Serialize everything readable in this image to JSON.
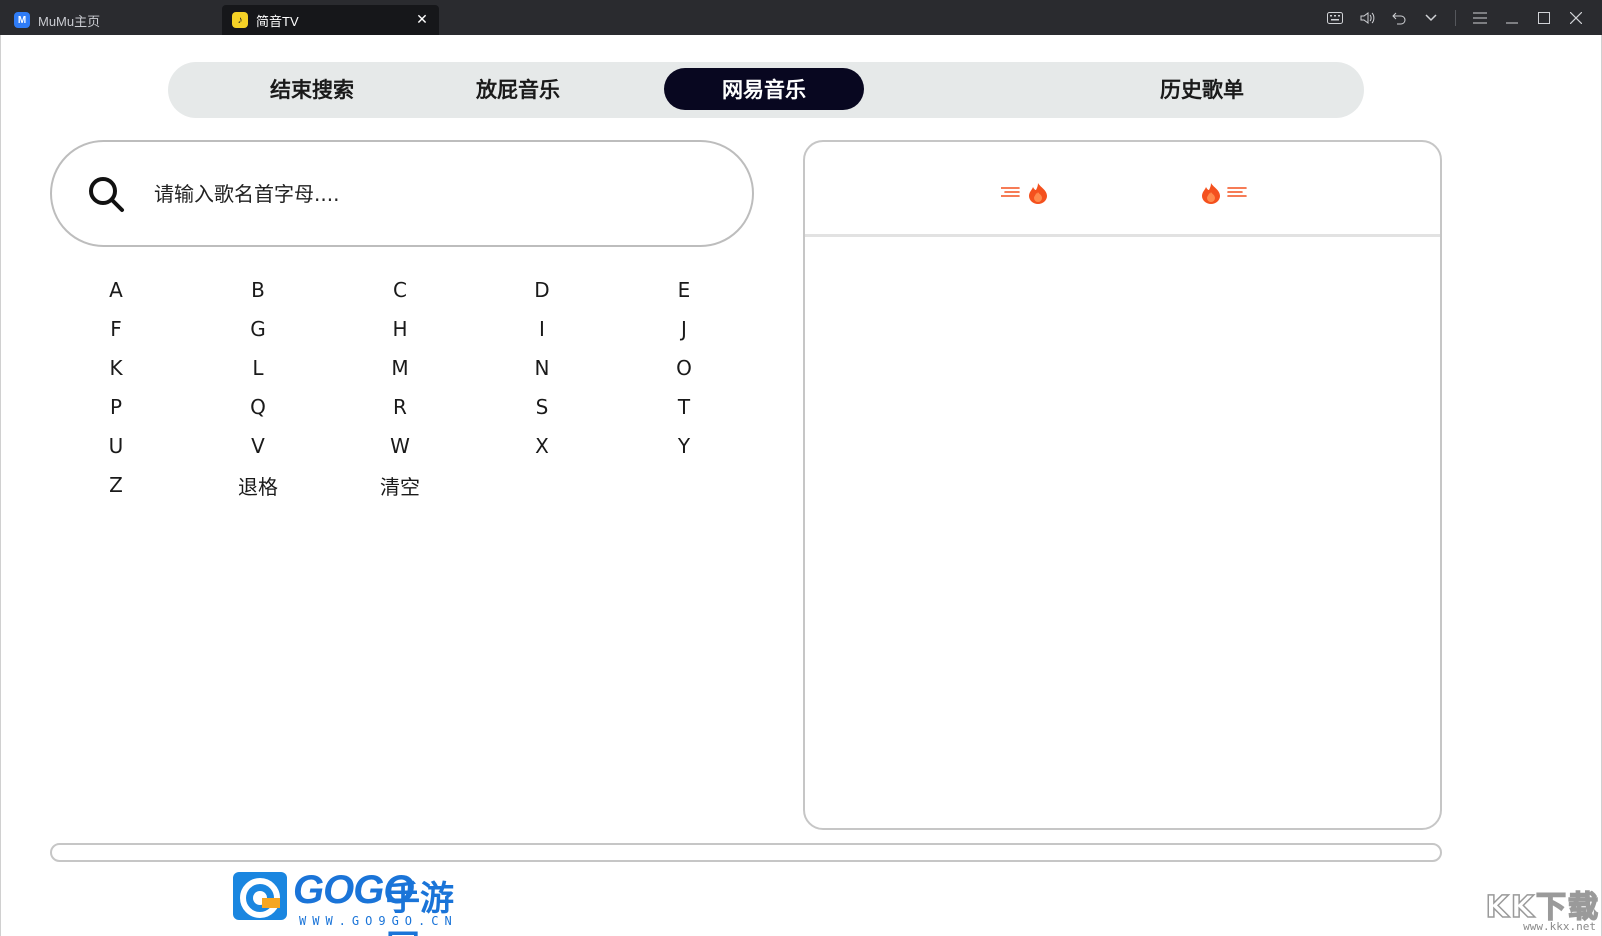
{
  "titlebar": {
    "tabs": [
      {
        "label": "MuMu主页",
        "icon": "mumu-logo-icon",
        "active": false
      },
      {
        "label": "简音TV",
        "icon": "app-icon",
        "active": true
      }
    ],
    "close_glyph": "✕",
    "controls": [
      "keyboard-icon",
      "volume-icon",
      "back-icon",
      "chevron-down-icon",
      "menu-icon",
      "minimize-icon",
      "maximize-icon",
      "close-icon"
    ]
  },
  "segmented": {
    "items": [
      {
        "label": "结束搜索"
      },
      {
        "label": "放屁音乐"
      },
      {
        "label": "网易音乐"
      },
      {
        "label": "历史歌单"
      }
    ],
    "active_index": 2
  },
  "search": {
    "placeholder": "请输入歌名首字母....",
    "value": ""
  },
  "keyboard": {
    "rows": [
      [
        "A",
        "B",
        "C",
        "D",
        "E"
      ],
      [
        "F",
        "G",
        "H",
        "I",
        "J"
      ],
      [
        "K",
        "L",
        "M",
        "N",
        "O"
      ],
      [
        "P",
        "Q",
        "R",
        "S",
        "T"
      ],
      [
        "U",
        "V",
        "W",
        "X",
        "Y"
      ],
      [
        "Z",
        "退格",
        "清空"
      ]
    ]
  },
  "panel": {
    "header_icons": [
      "fire-left-icon",
      "fire-right-icon"
    ]
  },
  "watermarks": {
    "gogo_text": "GOGO",
    "gogo_cn": "手游网",
    "gogo_url": "WWW.GO9GO.CN",
    "kk_text": "KK下载",
    "kk_url": "www.kkx.net"
  },
  "colors": {
    "titlebar_bg": "#2a2b2f",
    "segment_bg": "#e6e9e9",
    "segment_active": "#080720",
    "fire": "#f4511e"
  }
}
